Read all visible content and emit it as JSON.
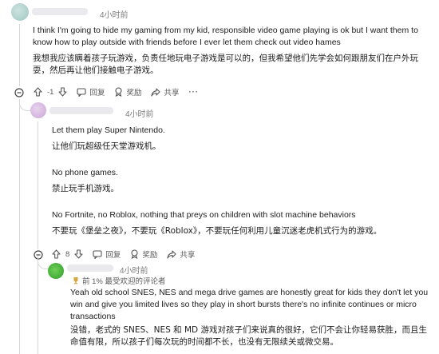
{
  "comments": [
    {
      "timestamp": "4小时前",
      "body_en": "I think I'm going to hide my gaming from my kid, responsible video game playing is ok but I want them to know how to play outside with friends before I ever let them check out video hames",
      "body_zh": "我想我应该瞒着孩子玩游戏，负责任地玩电子游戏是可以的，但我希望他们先学会如何跟朋友们在户外玩耍，然后再让他们接触电子游戏。",
      "actions": {
        "score": "-1",
        "reply": "回复",
        "award": "奖励",
        "share": "共享"
      }
    },
    {
      "timestamp": "4小时前",
      "paragraphs": [
        {
          "en": "Let them play Super Nintendo.",
          "zh": "让他们玩超级任天堂游戏机。"
        },
        {
          "en": "No phone games.",
          "zh": "禁止玩手机游戏。"
        },
        {
          "en": "No Fortnite, no Roblox, nothing that preys on children with slot machine behaviors",
          "zh": "不要玩《堡垒之夜》，不要玩《Roblox》，不要玩任何利用儿童沉迷老虎机式行为的游戏。"
        }
      ],
      "actions": {
        "score": "8",
        "reply": "回复",
        "award": "奖励",
        "share": "共享"
      }
    },
    {
      "timestamp": "4小时前",
      "badge": "前 1% 最受欢迎的评论者",
      "body_en": "Yeah old school SNES, NES and mega drive games are honestly great for kids they don't let you win and give you limited lives so they play in short bursts there's no infinite continues or micro transactions",
      "body_zh": "没错，老式的 SNES、NES 和 MD 游戏对孩子们来说真的很好，它们不会让你轻易获胜，而且生命值有限，所以孩子们每次玩的时间都不长，也没有无限续关或微交易。"
    }
  ],
  "icons": [
    "collapse-icon",
    "upvote-icon",
    "downvote-icon",
    "reply-icon",
    "award-icon",
    "share-icon",
    "trophy-icon"
  ],
  "colors": {
    "text": "#1c1c1c",
    "meta": "#7c7c7c",
    "thread_line": "#d7d7d7"
  }
}
